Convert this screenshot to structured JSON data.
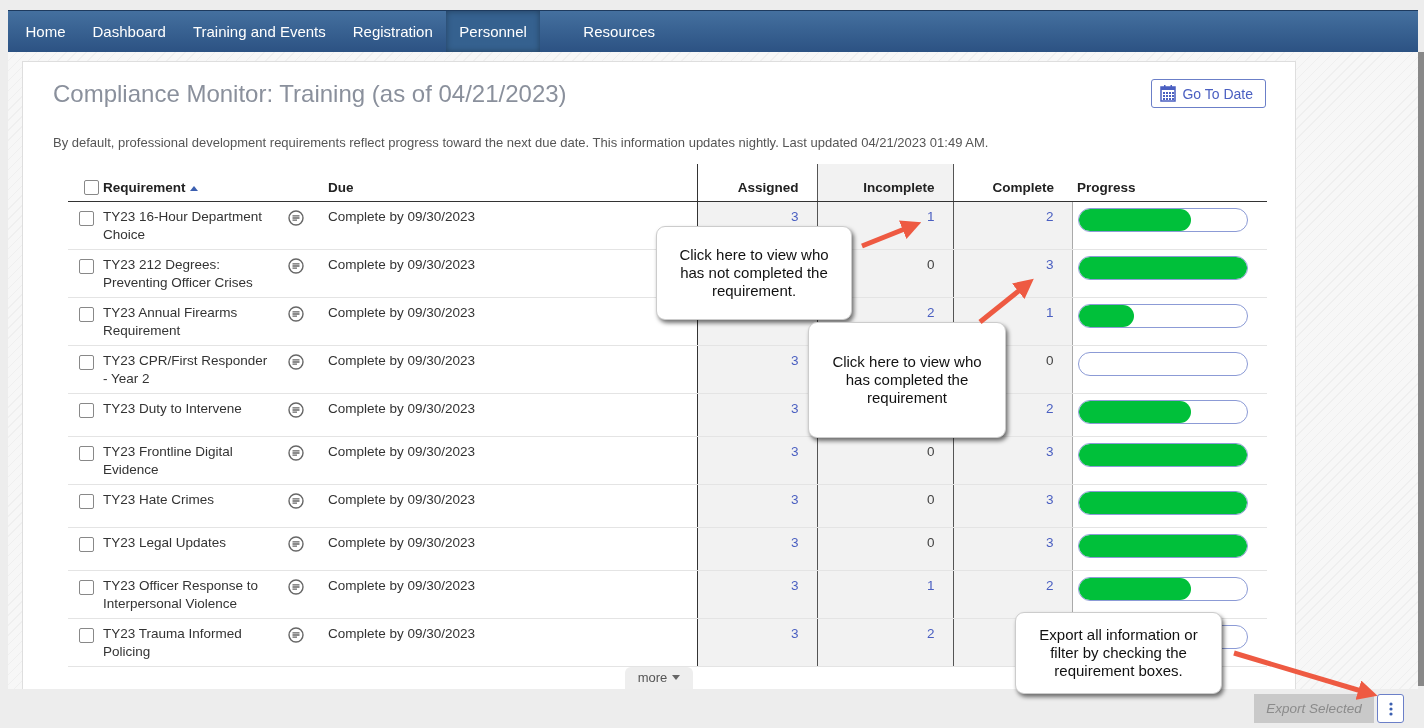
{
  "nav": [
    {
      "label": "Home",
      "selected": false
    },
    {
      "label": "Dashboard",
      "selected": false
    },
    {
      "label": "Training and Events",
      "selected": false
    },
    {
      "label": "Registration",
      "selected": false
    },
    {
      "label": "Personnel",
      "selected": true
    },
    {
      "label": "Resources",
      "selected": false
    }
  ],
  "title": "Compliance Monitor: Training (as of 04/21/2023)",
  "go_to_date_button": "Go To Date",
  "description": "By default, professional development requirements reflect progress toward the next due date. This information updates nightly. Last updated 04/21/2023 01:49 AM.",
  "table": {
    "select_all": {
      "checked": false
    },
    "columns": [
      "Requirement",
      "Due",
      "Assigned",
      "Incomplete",
      "Complete",
      "Progress"
    ],
    "rows": [
      {
        "checked": false,
        "requirement": "TY23 16-Hour Department Choice",
        "due": "Complete by 09/30/2023",
        "assigned": {
          "value": "3",
          "link": true
        },
        "incomplete": {
          "value": "1",
          "link": true
        },
        "complete": {
          "value": "2",
          "link": true
        },
        "level": 0.67
      },
      {
        "checked": false,
        "requirement": "TY23 212 Degrees: Preventing Officer Crises",
        "due": "Complete by 09/30/2023",
        "incomplete": {
          "value": "0",
          "link": false
        },
        "complete": {
          "value": "3",
          "link": true
        },
        "level": 1
      },
      {
        "checked": false,
        "requirement": "TY23 Annual Firearms Requirement",
        "due": "Complete by 09/30/2023",
        "incomplete": {
          "value": "2",
          "link": true
        },
        "complete": {
          "value": "1",
          "link": true
        },
        "level": 0.33
      },
      {
        "checked": false,
        "requirement": "TY23 CPR/First Responder - Year 2",
        "due": "Complete by 09/30/2023",
        "assigned": {
          "value": "3",
          "link": true
        },
        "complete": {
          "value": "0",
          "link": false
        },
        "level": 0
      },
      {
        "checked": false,
        "requirement": "TY23 Duty to Intervene",
        "due": "Complete by 09/30/2023",
        "assigned": {
          "value": "3",
          "link": true
        },
        "complete": {
          "value": "2",
          "link": true
        },
        "level": 0.67
      },
      {
        "checked": false,
        "requirement": "TY23 Frontline Digital Evidence",
        "due": "Complete by 09/30/2023",
        "assigned": {
          "value": "3",
          "link": true
        },
        "incomplete": {
          "value": "0",
          "link": false
        },
        "complete": {
          "value": "3",
          "link": true
        },
        "level": 1
      },
      {
        "checked": false,
        "requirement": "TY23 Hate Crimes",
        "due": "Complete by 09/30/2023",
        "assigned": {
          "value": "3",
          "link": true
        },
        "incomplete": {
          "value": "0",
          "link": false
        },
        "complete": {
          "value": "3",
          "link": true
        },
        "level": 1
      },
      {
        "checked": false,
        "requirement": "TY23 Legal Updates",
        "due": "Complete by 09/30/2023",
        "assigned": {
          "value": "3",
          "link": true
        },
        "incomplete": {
          "value": "0",
          "link": false
        },
        "complete": {
          "value": "3",
          "link": true
        },
        "level": 1
      },
      {
        "checked": false,
        "requirement": "TY23 Officer Response to Interpersonal Violence",
        "due": "Complete by 09/30/2023",
        "assigned": {
          "value": "3",
          "link": true
        },
        "incomplete": {
          "value": "1",
          "link": true
        },
        "complete": {
          "value": "2",
          "link": true
        },
        "level": 0.67
      },
      {
        "checked": false,
        "requirement": "TY23 Trauma Informed Policing",
        "due": "Complete by 09/30/2023",
        "assigned": {
          "value": "3",
          "link": true
        },
        "incomplete": {
          "value": "2",
          "link": true
        }
      }
    ]
  },
  "more_button": "more",
  "export_button": {
    "label": "Export Selected",
    "disabled": true
  },
  "callouts": [
    "Click here to view who has not completed the requirement.",
    "Click here to view who has completed the requirement",
    "Export all information or filter by checking the requirement boxes."
  ]
}
